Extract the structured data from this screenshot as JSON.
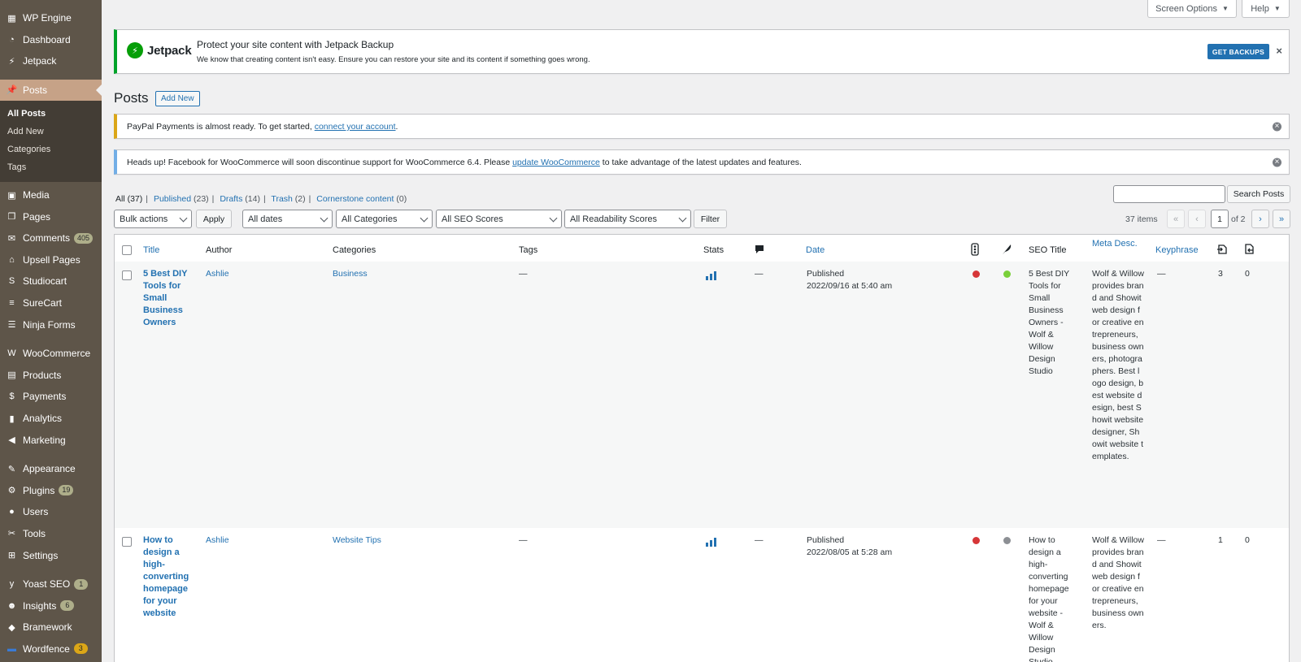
{
  "sidebar": {
    "items": [
      {
        "id": "wpengine",
        "label": "WP Engine",
        "icon": "grid-icon"
      },
      {
        "id": "dashboard",
        "label": "Dashboard",
        "icon": "dashboard-icon"
      },
      {
        "id": "jetpack",
        "label": "Jetpack",
        "icon": "jetpack-icon"
      },
      {
        "id": "posts",
        "label": "Posts",
        "icon": "pin-icon",
        "active": true
      },
      {
        "id": "media",
        "label": "Media",
        "icon": "media-icon"
      },
      {
        "id": "pages",
        "label": "Pages",
        "icon": "pages-icon"
      },
      {
        "id": "comments",
        "label": "Comments",
        "icon": "comment-icon",
        "badge": "405"
      },
      {
        "id": "upsell",
        "label": "Upsell Pages",
        "icon": "bag-icon"
      },
      {
        "id": "studiocart",
        "label": "Studiocart",
        "icon": "studiocart-icon"
      },
      {
        "id": "surecart",
        "label": "SureCart",
        "icon": "surecart-icon"
      },
      {
        "id": "ninja",
        "label": "Ninja Forms",
        "icon": "forms-icon"
      },
      {
        "id": "woocommerce",
        "label": "WooCommerce",
        "icon": "woo-icon"
      },
      {
        "id": "products",
        "label": "Products",
        "icon": "archive-icon"
      },
      {
        "id": "payments",
        "label": "Payments",
        "icon": "dollar-icon"
      },
      {
        "id": "analytics",
        "label": "Analytics",
        "icon": "bar-chart-icon"
      },
      {
        "id": "marketing",
        "label": "Marketing",
        "icon": "megaphone-icon"
      },
      {
        "id": "appearance",
        "label": "Appearance",
        "icon": "brush-icon"
      },
      {
        "id": "plugins",
        "label": "Plugins",
        "icon": "plug-icon",
        "badge": "19"
      },
      {
        "id": "users",
        "label": "Users",
        "icon": "user-icon"
      },
      {
        "id": "tools",
        "label": "Tools",
        "icon": "wrench-icon"
      },
      {
        "id": "settings",
        "label": "Settings",
        "icon": "sliders-icon"
      },
      {
        "id": "yoast",
        "label": "Yoast SEO",
        "icon": "yoast-icon",
        "badge": "1"
      },
      {
        "id": "insights",
        "label": "Insights",
        "icon": "insights-icon",
        "badge": "6"
      },
      {
        "id": "bramework",
        "label": "Bramework",
        "icon": "bramework-icon"
      },
      {
        "id": "wordfence",
        "label": "Wordfence",
        "icon": "wordfence-icon",
        "badge": "3"
      }
    ],
    "submenu": [
      "All Posts",
      "Add New",
      "Categories",
      "Tags"
    ]
  },
  "top_tabs": {
    "screen_options": "Screen Options",
    "help": "Help"
  },
  "jetpack_notice": {
    "brand": "Jetpack",
    "title": "Protect your site content with Jetpack Backup",
    "desc": "We know that creating content isn't easy. Ensure you can restore your site and its content if something goes wrong.",
    "button": "GET BACKUPS"
  },
  "page": {
    "title": "Posts",
    "add_new": "Add New"
  },
  "paypal_notice": {
    "text": "PayPal Payments is almost ready. To get started, ",
    "link": "connect your account",
    "after": "."
  },
  "facebook_notice": {
    "text": "Heads up! Facebook for WooCommerce will soon discontinue support for WooCommerce 6.4. Please ",
    "link": "update WooCommerce",
    "after": " to take advantage of the latest updates and features."
  },
  "views": [
    {
      "label": "All",
      "count": "(37)",
      "current": true
    },
    {
      "label": "Published",
      "count": "(23)"
    },
    {
      "label": "Drafts",
      "count": "(14)"
    },
    {
      "label": "Trash",
      "count": "(2)"
    },
    {
      "label": "Cornerstone content",
      "count": "(0)"
    }
  ],
  "search": {
    "button": "Search Posts",
    "value": ""
  },
  "filters": {
    "bulk": "Bulk actions",
    "apply": "Apply",
    "dates": "All dates",
    "categories": "All Categories",
    "seo": "All SEO Scores",
    "readability": "All Readability Scores",
    "filter": "Filter"
  },
  "pagination": {
    "items": "37 items",
    "first": "«",
    "prev": "‹",
    "current": "1",
    "of": "of 2",
    "next": "›",
    "last": "»"
  },
  "columns": {
    "title": "Title",
    "author": "Author",
    "categories": "Categories",
    "tags": "Tags",
    "stats": "Stats",
    "date": "Date",
    "seo_title": "SEO Title",
    "meta": "Meta Desc.",
    "keyphrase": "Keyphrase"
  },
  "rows": [
    {
      "title": " 5 Best DIY Tools for Small Business Owners",
      "author": "Ashlie",
      "category": "Business",
      "tags": "—",
      "comments": "—",
      "status": "Published",
      "date": "2022/09/16 at 5:40 am",
      "seo_color": "#d63638",
      "read_color": "#7ad03a",
      "seo_title": " 5 Best DIY Tools for Small Business Owners - Wolf & Willow Design Studio",
      "meta": "Wolf & Willow provides brand and Showit web design for creative entrepreneurs, business owners, photographers. Best logo design, best website design, best Showit website designer, Showit website templates.",
      "keyphrase": "—",
      "links_out": "3",
      "links_in": "0"
    },
    {
      "title": "How to design a high-converting homepage for your website",
      "author": "Ashlie",
      "category": "Website Tips",
      "tags": "—",
      "comments": "—",
      "status": "Published",
      "date": "2022/08/05 at 5:28 am",
      "seo_color": "#d63638",
      "read_color": "#8c8f94",
      "seo_title": "How to design a high-converting homepage for your website - Wolf & Willow Design Studio",
      "meta": "Wolf & Willow provides brand and Showit web design for creative entrepreneurs, business owners.",
      "keyphrase": "—",
      "links_out": "1",
      "links_in": "0"
    }
  ]
}
